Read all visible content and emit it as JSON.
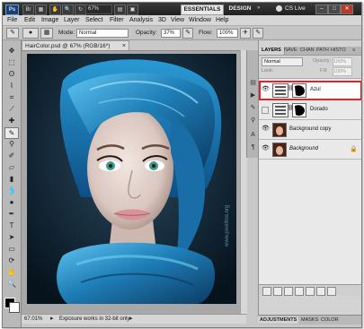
{
  "app": {
    "logo": "Ps",
    "zoom": "67%",
    "workspaces": [
      "ESSENTIALS",
      "DESIGN"
    ],
    "cs_live": "CS Live"
  },
  "menu": [
    "File",
    "Edit",
    "Image",
    "Layer",
    "Select",
    "Filter",
    "Analysis",
    "3D",
    "View",
    "Window",
    "Help"
  ],
  "options": {
    "mode_label": "Mode:",
    "mode_value": "Normal",
    "opacity_label": "Opacity:",
    "opacity_value": "37%",
    "flow_label": "Flow:",
    "flow_value": "100%"
  },
  "document": {
    "tab_title": "HairColor.psd @ 67% (RGB/16*)",
    "watermark": "www.pixelitos.org",
    "status_zoom": "67.01%",
    "status_message": "Exposure works in 32-bit only"
  },
  "layers_panel": {
    "tabs": [
      "LAYERS",
      "NAVE",
      "CHAN",
      "PATH",
      "HISTO"
    ],
    "blend_mode": "Normal",
    "opacity_label": "Opacity:",
    "opacity_value": "100%",
    "lock_label": "Lock:",
    "fill_label": "Fill:",
    "fill_value": "100%",
    "layers": [
      {
        "name": "Azul",
        "selected": true
      },
      {
        "name": "Dorado",
        "selected": false
      },
      {
        "name": "Background copy",
        "selected": false
      },
      {
        "name": "Background",
        "selected": false
      }
    ],
    "bottom_tabs": [
      "ADJUSTMENTS",
      "MASKS",
      "COLOR"
    ]
  },
  "colors": {
    "hair_blue": "#1f7fb8",
    "selection_outline": "#d7262e"
  }
}
